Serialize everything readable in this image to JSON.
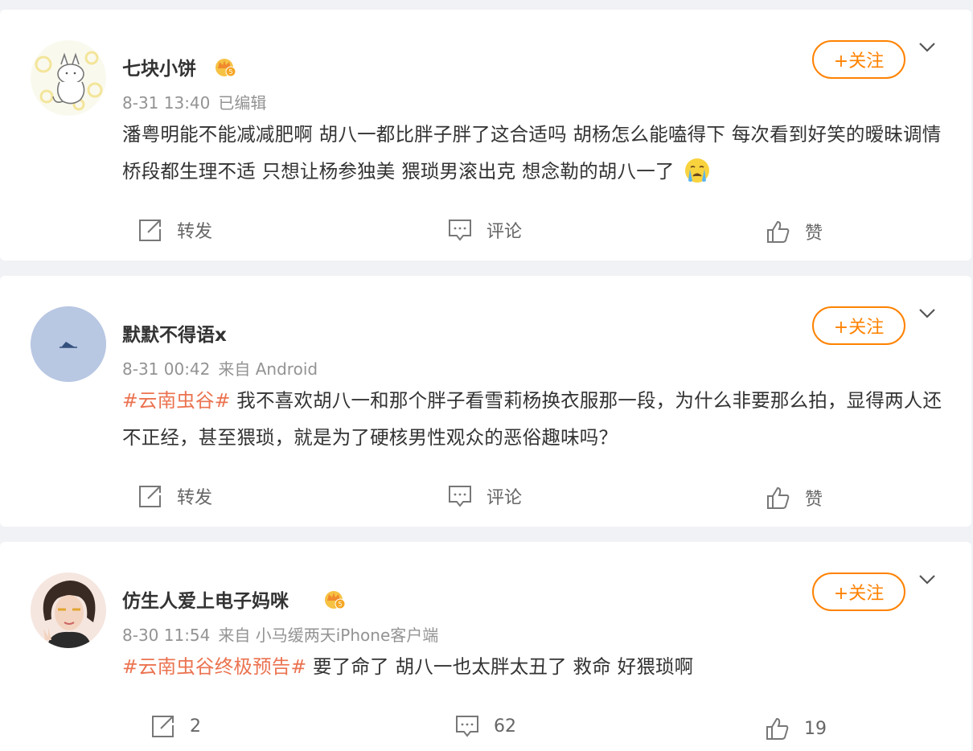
{
  "posts": [
    {
      "username": "七块小饼",
      "time": "8-31 13:40",
      "meta_extra": "已编辑",
      "topic": "",
      "text": "潘粤明能不能减减肥啊 胡八一都比胖子胖了这合适吗 胡杨怎么能嗑得下 每次看到好笑的暧昧调情桥段都生理不适 只想让杨参独美 猥琐男滚出克 想念勒的胡八一了",
      "emoji": "crying-face-icon",
      "follow_label": "+关注",
      "repost_label": "转发",
      "comment_label": "评论",
      "like_label": "赞",
      "badge": "crown-badge-icon"
    },
    {
      "username": "默默不得语x",
      "time": "8-31 00:42",
      "meta_extra": "来自 Android",
      "topic": "#云南虫谷#",
      "text": " 我不喜欢胡八一和那个胖子看雪莉杨换衣服那一段，为什么非要那么拍，显得两人还不正经，甚至猥琐，就是为了硬核男性观众的恶俗趣味吗？",
      "follow_label": "+关注",
      "repost_label": "转发",
      "comment_label": "评论",
      "like_label": "赞"
    },
    {
      "username": "仿生人爱上电子妈咪",
      "time": "8-30 11:54",
      "meta_extra": "来自 小马缓两天iPhone客户端",
      "topic": "#云南虫谷终极预告#",
      "text": " 要了命了 胡八一也太胖太丑了 救命 好猥琐啊",
      "follow_label": "+关注",
      "repost_label": "2",
      "comment_label": "62",
      "like_label": "19",
      "badge": "crown-badge-icon"
    }
  ],
  "colors": {
    "accent": "#ff8200",
    "topic": "#eb7350",
    "background": "#f1f2f5",
    "meta": "#939393"
  }
}
